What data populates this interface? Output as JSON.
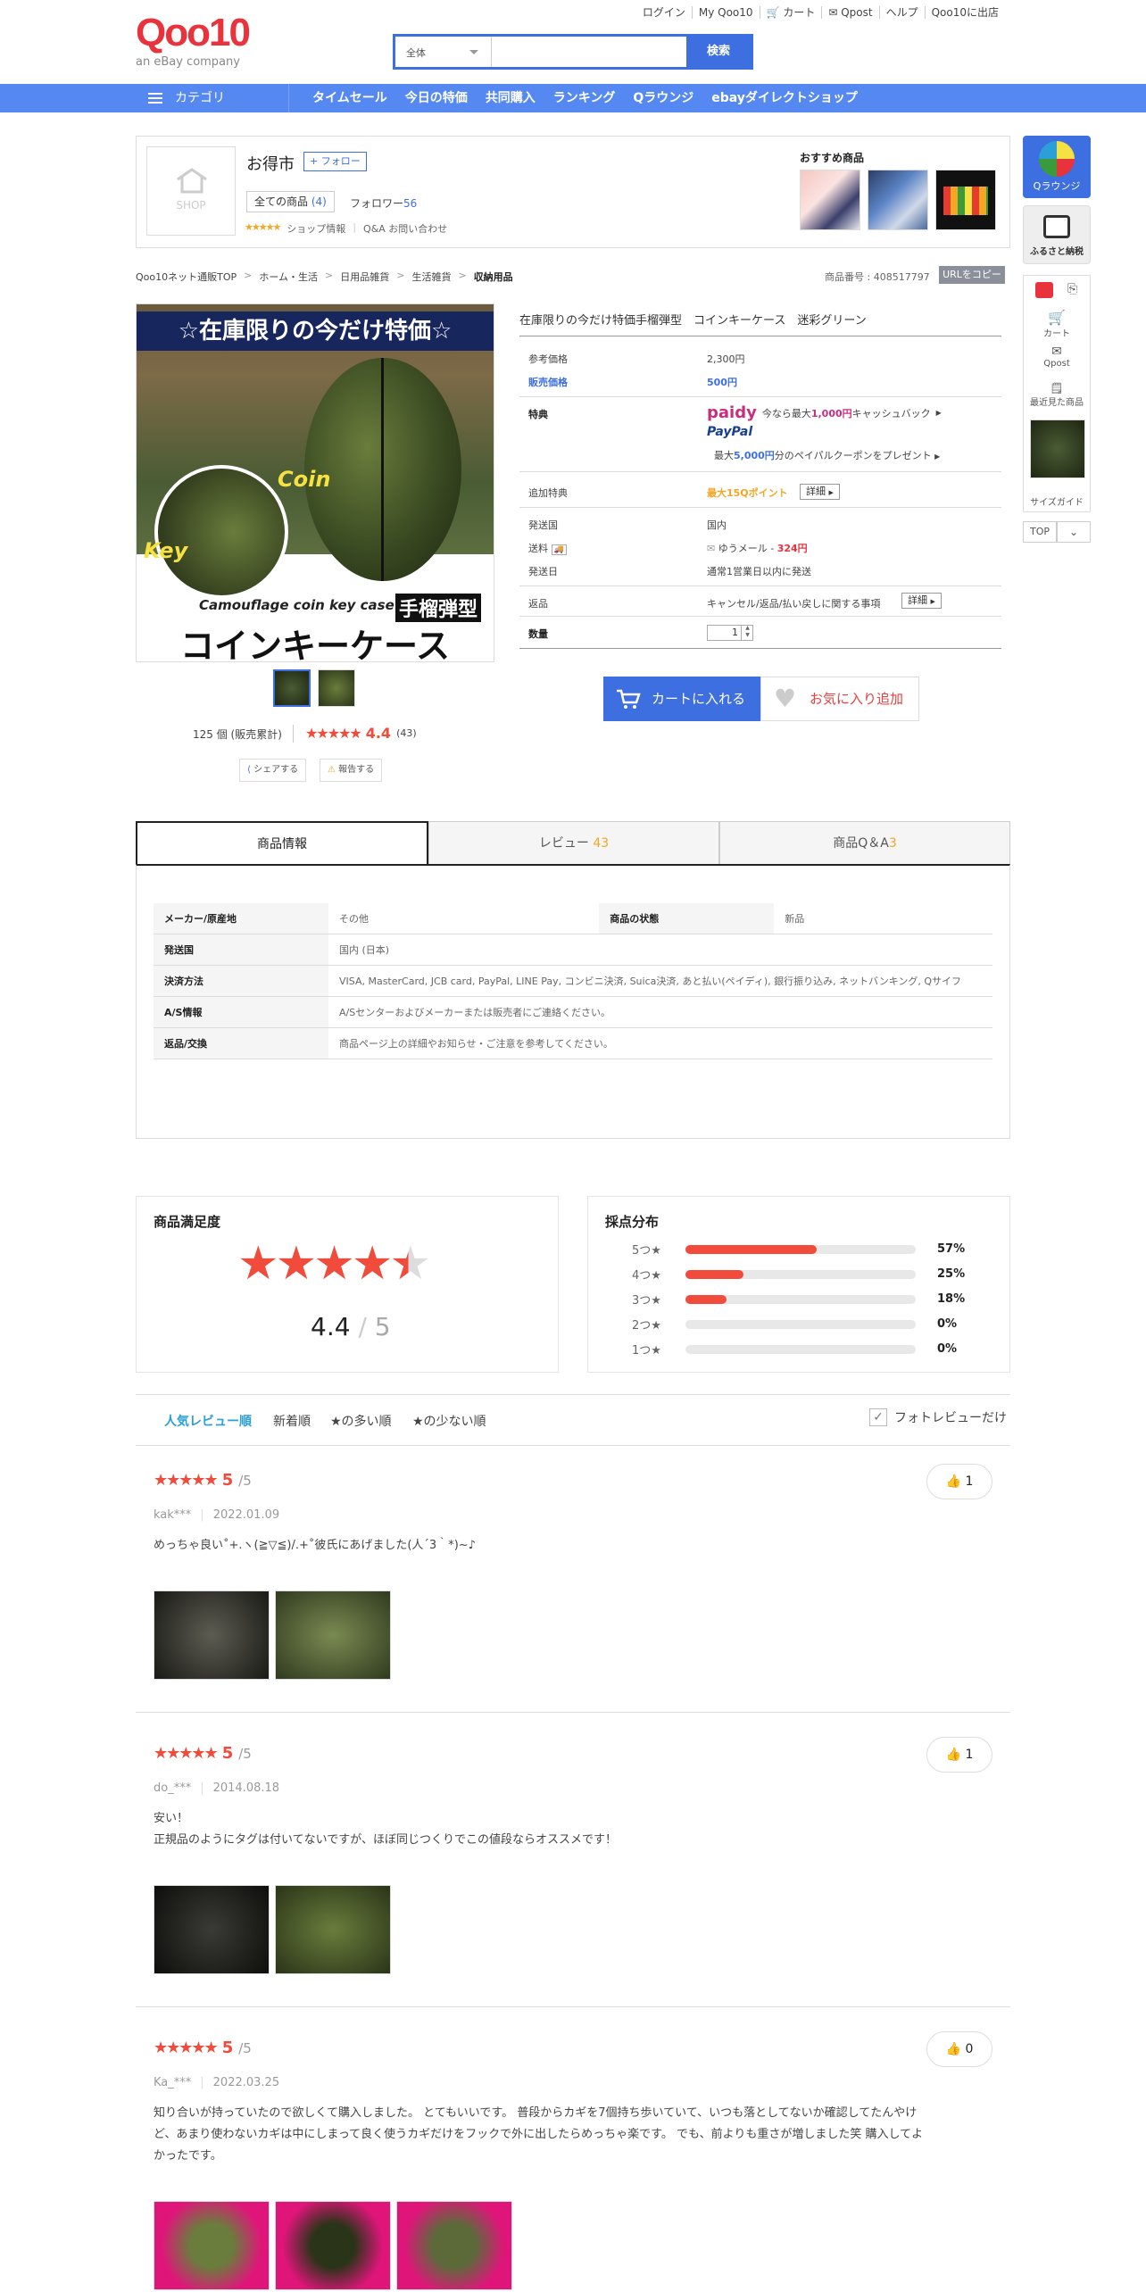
{
  "header": {
    "logo_text": "Qoo10",
    "logo_sub": "an eBay company",
    "top_links": [
      "ログイン",
      "My Qoo10",
      "カート",
      "Qpost",
      "ヘルプ",
      "Qoo10に出店"
    ],
    "search_category": "全体",
    "search_placeholder": "",
    "search_button": "検索"
  },
  "nav": {
    "category_label": "カテゴリ",
    "items": [
      "タイムセール",
      "今日の特価",
      "共同購入",
      "ランキング",
      "Qラウンジ",
      "ebayダイレクトショップ"
    ]
  },
  "shop": {
    "img_label": "SHOP",
    "name": "お得市",
    "follow_label": "+ フォロー",
    "all_items_label": "全ての商品",
    "all_items_count": "(4)",
    "followers_label": "フォロワー",
    "followers_count": "56",
    "shop_info_label": "ショップ情報",
    "qa_label": "Q&A お問い合わせ",
    "recommend_label": "おすすめ商品"
  },
  "breadcrumb": [
    "Qoo10ネット通販TOP",
    "ホーム・生活",
    "日用品雑貨",
    "生活雑貨",
    "収納用品"
  ],
  "item_no_label": "商品番号 : 408517797",
  "copy_url_label": "URLをコピー",
  "product": {
    "banner_top": "☆在庫限りの今だけ特価☆",
    "banner_coin": "Coin",
    "banner_key": "Key",
    "banner_sub": "Camouflage coin key case",
    "banner_type": "手榴弾型",
    "banner_main": "コインキーケース",
    "sold_text": "125 個 (販売累計)",
    "rating": "4.4",
    "rating_count": "(43)",
    "share_label": "シェアする",
    "report_label": "報告する",
    "title": "在庫限りの今だけ特価手榴弾型　コインキーケース　迷彩グリーン",
    "ref_price_label": "参考価格",
    "ref_price": "2,300円",
    "sale_price_label": "販売価格",
    "sale_price": "500円",
    "benefit_label": "特典",
    "paidy_brand": "paidy",
    "paidy_pre": "今なら最大",
    "paidy_amount": "1,000円",
    "paidy_post": "キャッシュバック",
    "paypal_brand": "PayPal",
    "paypal_pre": "最大",
    "paypal_amount": "5,000円",
    "paypal_post": "分のペイパルクーポンをプレゼント",
    "extra_label": "追加特典",
    "extra_value": "最大15Qポイント",
    "detail_label": "詳細",
    "ship_from_label": "発送国",
    "ship_from": "国内",
    "shipping_label": "送料",
    "shipping_method": "ゆうメール -",
    "shipping_fee": "324円",
    "ship_date_label": "発送日",
    "ship_date": "通常1営業日以内に発送",
    "return_label": "返品",
    "return_value": "キャンセル/返品/払い戻しに関する事項",
    "qty_label": "数量",
    "qty_value": "1",
    "cart_button": "カートに入れる",
    "fav_button": "お気に入り追加"
  },
  "tabs": [
    {
      "label": "商品情報",
      "count": ""
    },
    {
      "label": "レビュー",
      "count": "43"
    },
    {
      "label": "商品Q＆A",
      "count": "3"
    }
  ],
  "info_table": {
    "maker_label": "メーカー/原産地",
    "maker": "その他",
    "condition_label": "商品の状態",
    "condition": "新品",
    "ship_country_label": "発送国",
    "ship_country": "国内 (日本)",
    "payment_label": "決済方法",
    "payment": "VISA, MasterCard, JCB card, PayPal, LINE Pay, コンビニ決済, Suica決済, あと払い(ペイディ), 銀行振り込み, ネットバンキング, Qサイフ",
    "as_label": "A/S情報",
    "as": "A/Sセンターおよびメーカーまたは販売者にご連絡ください。",
    "return_label": "返品/交換",
    "return": "商品ページ上の詳細やお知らせ・ご注意を参考してください。"
  },
  "satisfaction": {
    "title": "商品満足度",
    "score": "4.4",
    "out_of": "5"
  },
  "distribution": {
    "title": "採点分布",
    "rows": [
      {
        "label": "5つ★",
        "percent": "57%",
        "value": 57
      },
      {
        "label": "4つ★",
        "percent": "25%",
        "value": 25
      },
      {
        "label": "3つ★",
        "percent": "18%",
        "value": 18
      },
      {
        "label": "2つ★",
        "percent": "0%",
        "value": 0
      },
      {
        "label": "1つ★",
        "percent": "0%",
        "value": 0
      }
    ]
  },
  "sort": {
    "options": [
      "人気レビュー順",
      "新着順",
      "★の多い順",
      "★の少ない順"
    ],
    "photo_only": "フォトレビューだけ"
  },
  "reviews": [
    {
      "score": "5",
      "of": "/5",
      "user": "kak***",
      "date": "2022.01.09",
      "likes": "1",
      "lines": [
        "めっちゃ良い˚+.ヽ(≧▽≦)/.+˚彼氏にあげました(人´3｀*)~♪"
      ]
    },
    {
      "score": "5",
      "of": "/5",
      "user": "do_***",
      "date": "2014.08.18",
      "likes": "1",
      "lines": [
        "安い！",
        "正規品のようにタグは付いてないですが、ほぼ同じつくりでこの値段ならオススメです！"
      ]
    },
    {
      "score": "5",
      "of": "/5",
      "user": "Ka_***",
      "date": "2022.03.25",
      "likes": "0",
      "lines": [
        "知り合いが持っていたので欲しくて購入しました。 とてもいいです。 普段からカギを7個持ち歩いていて、いつも落としてないか確認してたんやけ",
        "ど、あまり使わないカギは中にしまって良く使うカギだけをフックで外に出したらめっちゃ楽です。 でも、前よりも重さが増しました笑 購入してよ",
        "かったです。"
      ]
    }
  ],
  "sidebar": {
    "lounge": "Qラウンジ",
    "furusato": "ふるさと納税",
    "cart": "カート",
    "qpost": "Qpost",
    "recent": "最近見た商品",
    "size_guide": "サイズガイド",
    "top": "TOP"
  },
  "colors": {
    "brand_red": "#e8323c",
    "brand_blue": "#3e6fe0",
    "nav_blue": "#5588f0",
    "star_red": "#f04b3b"
  }
}
